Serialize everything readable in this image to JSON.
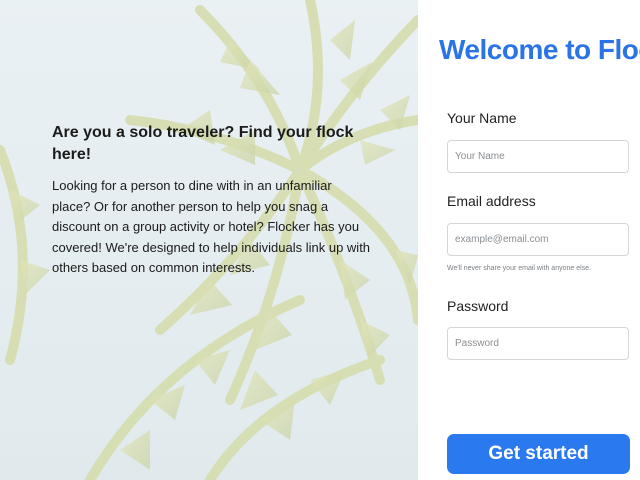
{
  "hero": {
    "title": "Are you a solo traveler? Find your flock here!",
    "text": "Looking for a person to dine with in an unfamiliar place? Or for another person to help you snag a discount on a group activity or hotel? Flocker has you covered! We're designed to help individuals link up with others based on common interests."
  },
  "form": {
    "title": "Welcome to Flock",
    "name_label": "Your Name",
    "name_placeholder": "Your Name",
    "email_label": "Email address",
    "email_placeholder": "example@email.com",
    "email_help": "We'll never share your email with anyone else.",
    "password_label": "Password",
    "password_placeholder": "Password",
    "submit_label": "Get started"
  },
  "colors": {
    "accent": "#2a74e6",
    "button": "#2b79ee"
  }
}
